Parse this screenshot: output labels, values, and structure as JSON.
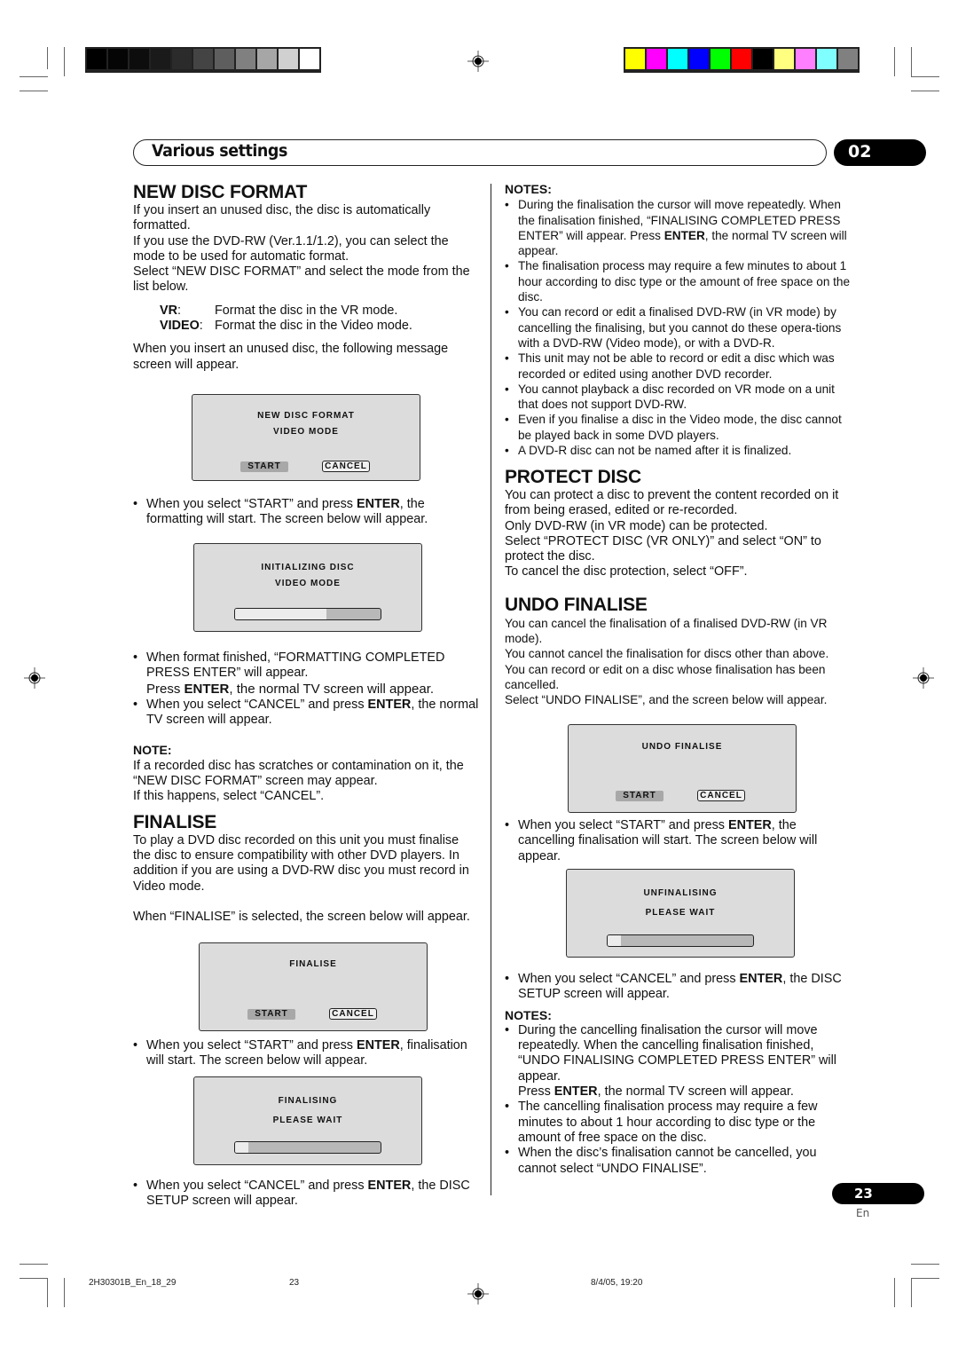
{
  "print_marks": {
    "grayscale_bar": [
      "#000000",
      "#050505",
      "#0d0d0d",
      "#1a1a1a",
      "#2b2b2b",
      "#444444",
      "#5e5e5e",
      "#808080",
      "#a6a6a6",
      "#d0d0d0",
      "#ffffff"
    ],
    "color_bar": [
      "#ffff00",
      "#ff00ff",
      "#00ffff",
      "#0000ff",
      "#00ff00",
      "#ff0000",
      "#000000",
      "#ffff80",
      "#ff80ff",
      "#80ffff",
      "#808080"
    ]
  },
  "header": {
    "title": "Various settings",
    "chapter": "02"
  },
  "left": {
    "new_disc_format": {
      "heading": "NEW DISC FORMAT",
      "intro": [
        "If you insert an unused disc, the disc is automatically formatted.",
        "If you use the DVD-RW (Ver.1.1/1.2), you can select the mode to be used for automatic format.",
        "Select “NEW DISC FORMAT” and select the mode from the list below."
      ],
      "modes": [
        {
          "term": "VR",
          "desc": "Format the disc in the VR mode."
        },
        {
          "term": "VIDEO",
          "desc": "Format the disc in the Video mode."
        }
      ],
      "after_modes": "When you insert an unused disc, the following message screen will appear.",
      "screen1": {
        "line1": "NEW DISC FORMAT",
        "line2": "VIDEO MODE",
        "start": "START",
        "cancel": "CANCEL"
      },
      "bullet1": {
        "pre": "When you select “START” and press ",
        "bold": "ENTER",
        "post": ", the formatting will start. The screen below will appear."
      },
      "screen2": {
        "line1": "INITIALIZING DISC",
        "line2": "VIDEO MODE",
        "progress": 0.63
      },
      "bullet2": {
        "text": "When format finished, “FORMATTING COMPLETED PRESS ENTER” will appear.",
        "sub_pre": "Press ",
        "sub_bold": "ENTER",
        "sub_post": ", the normal TV screen will appear."
      },
      "bullet3": {
        "pre": "When you select “CANCEL” and press ",
        "bold": "ENTER",
        "post": ", the normal TV screen will appear."
      },
      "note_heading": "NOTE:",
      "note_lines": [
        "If a recorded disc has scratches or contamination on it, the “NEW DISC FORMAT” screen may appear.",
        "If this happens, select “CANCEL”."
      ]
    },
    "finalise": {
      "heading": "FINALISE",
      "intro": "To play a DVD disc recorded on this unit you must finalise the disc to ensure compatibility with other DVD players. In addition if you are using a DVD-RW disc you must record in Video mode.",
      "when": "When “FINALISE” is selected, the screen below will appear.",
      "screen1": {
        "line1": "FINALISE",
        "start": "START",
        "cancel": "CANCEL"
      },
      "bullet1": {
        "pre": "When you select “START” and press ",
        "bold": "ENTER",
        "post": ", finalisation will start. The screen below will appear."
      },
      "screen2": {
        "line1": "FINALISING",
        "line2": "PLEASE WAIT",
        "progress": 0.09
      },
      "bullet2": {
        "pre": "When you select “CANCEL” and press ",
        "bold": "ENTER",
        "post": ", the DISC SETUP screen will appear."
      }
    }
  },
  "right": {
    "notes_heading": "NOTES:",
    "notes": [
      {
        "pre": "During the finalisation the cursor will move repeatedly. When the finalisation finished, “FINALISING COMPLETED PRESS ENTER” will appear. Press ",
        "bold": "ENTER",
        "post": ", the normal TV screen will appear."
      },
      {
        "pre": "The finalisation process may require a few minutes to about 1 hour  according to disc type or the amount of free space on the disc.",
        "bold": "",
        "post": ""
      },
      {
        "pre": "You can record or edit a finalised DVD-RW (in VR mode) by cancelling the finalising, but you cannot do these opera-tions with a DVD-RW (Video mode), or with a DVD-R.",
        "bold": "",
        "post": ""
      },
      {
        "pre": "This unit may not be able to record or edit a disc which was recorded or edited using another DVD recorder.",
        "bold": "",
        "post": ""
      },
      {
        "pre": "You cannot playback a disc recorded on VR mode on a unit that does not support DVD-RW.",
        "bold": "",
        "post": ""
      },
      {
        "pre": "Even if you finalise a disc in the Video mode, the disc cannot be played back in some DVD players.",
        "bold": "",
        "post": ""
      },
      {
        "pre": "A DVD-R disc can not be named after it is finalized.",
        "bold": "",
        "post": ""
      }
    ],
    "protect_disc": {
      "heading": "PROTECT DISC",
      "lines": [
        "You can protect a disc to prevent the content recorded on it from being erased, edited or re-recorded.",
        "Only DVD-RW (in VR mode) can be protected.",
        "Select “PROTECT DISC (VR ONLY)” and select “ON” to protect the disc.",
        "To cancel the disc protection, select “OFF”."
      ]
    },
    "undo_finalise": {
      "heading": "UNDO FINALISE",
      "lines": [
        "You can cancel the finalisation of a finalised DVD-RW (in VR mode).",
        "You cannot cancel the finalisation for discs other than above.",
        "You can record or edit on a disc whose finalisation has been cancelled.",
        "Select “UNDO FINALISE”, and the screen below will appear."
      ],
      "screen1": {
        "line1": "UNDO FINALISE",
        "start": "START",
        "cancel": "CANCEL"
      },
      "bullet1": {
        "pre": "When you select “START” and press ",
        "bold": "ENTER",
        "post": ", the cancelling finalisation will start. The screen below will appear."
      },
      "screen2": {
        "line1": "UNFINALISING",
        "line2": "PLEASE WAIT",
        "progress": 0.09
      },
      "bullet2": {
        "pre": "When you select “CANCEL” and press ",
        "bold": "ENTER",
        "post": ", the DISC SETUP screen will appear."
      },
      "notes_heading": "NOTES:",
      "note1": {
        "text": "During the cancelling finalisation the cursor will move repeatedly. When the cancelling finalisation finished, “UNDO FINALISING COMPLETED PRESS ENTER” will appear.",
        "sub_pre": "Press ",
        "sub_bold": "ENTER",
        "sub_post": ", the normal TV screen will appear."
      },
      "note2": "The cancelling finalisation process may require a few minutes to about 1 hour according to disc type or the amount of free space on the disc.",
      "note3": "When the disc’s finalisation cannot be cancelled, you cannot select “UNDO FINALISE”."
    }
  },
  "page": {
    "number": "23",
    "lang": "En"
  },
  "footer": {
    "file": "2H30301B_En_18_29",
    "page": "23",
    "date": "8/4/05, 19:20"
  }
}
